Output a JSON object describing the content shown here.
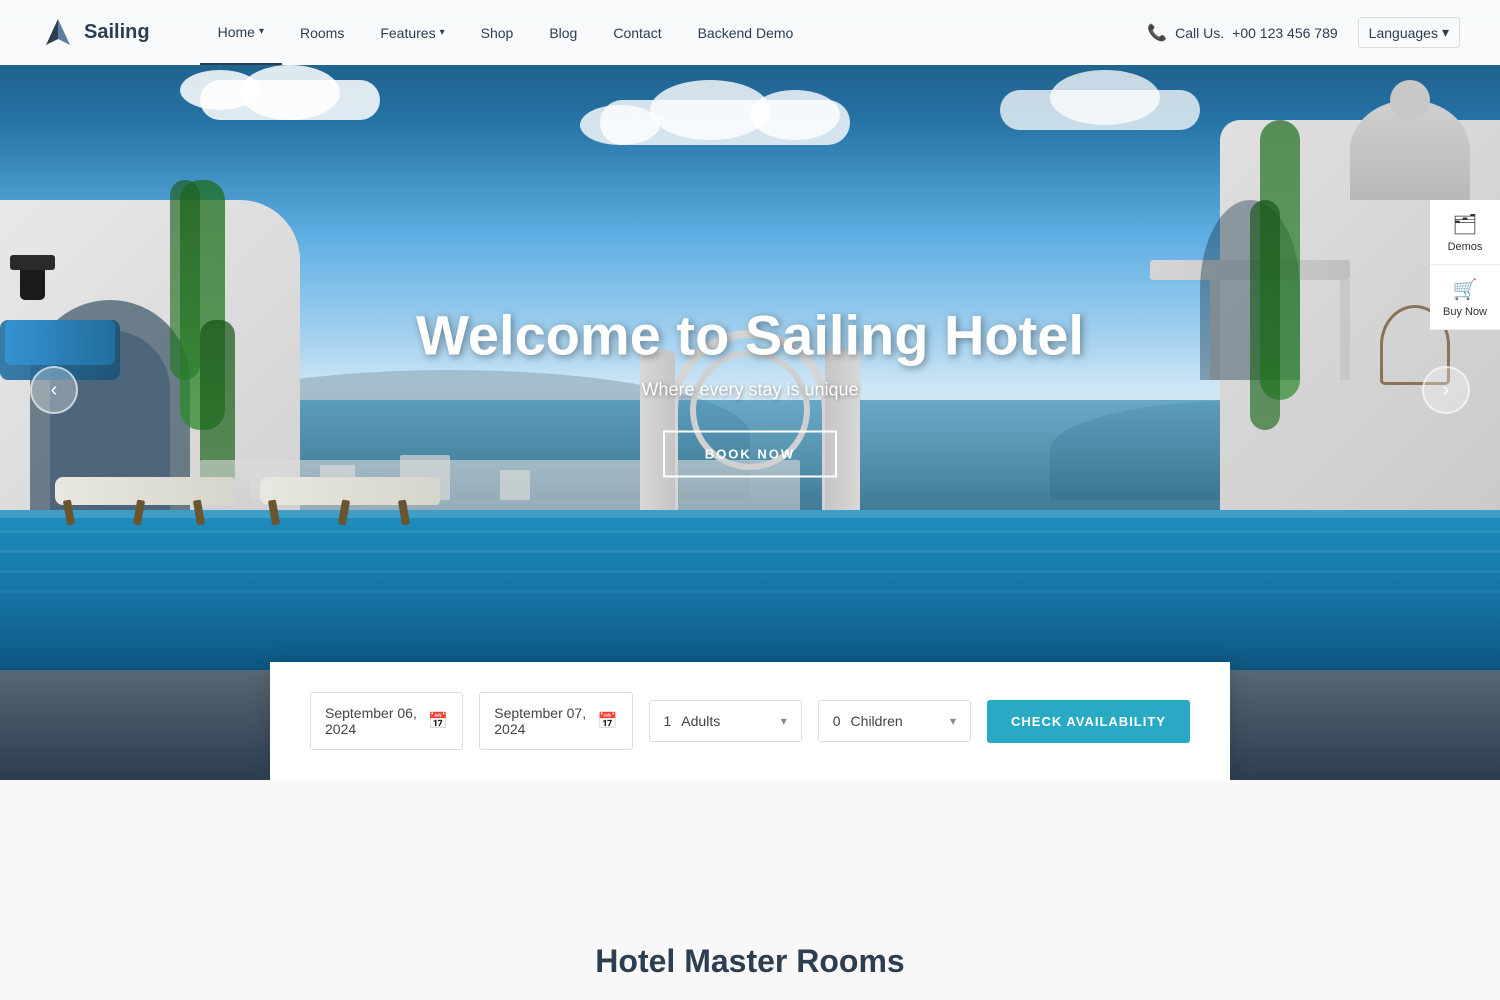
{
  "brand": {
    "name": "Sailing",
    "tagline": "Where every stay is unique"
  },
  "navbar": {
    "logo_text": "Sailing",
    "nav_items": [
      {
        "label": "Home",
        "active": true,
        "has_dropdown": true
      },
      {
        "label": "Rooms",
        "active": false,
        "has_dropdown": false
      },
      {
        "label": "Features",
        "active": false,
        "has_dropdown": true
      },
      {
        "label": "Shop",
        "active": false,
        "has_dropdown": false
      },
      {
        "label": "Blog",
        "active": false,
        "has_dropdown": false
      },
      {
        "label": "Contact",
        "active": false,
        "has_dropdown": false
      },
      {
        "label": "Backend Demo",
        "active": false,
        "has_dropdown": false
      }
    ],
    "call_label": "Call Us.",
    "call_number": "+00 123 456 789",
    "languages_label": "Languages"
  },
  "hero": {
    "title": "Welcome to Sailing Hotel",
    "subtitle": "Where every stay is unique",
    "cta_label": "BOOK NOW"
  },
  "side_widgets": [
    {
      "icon": "🗂",
      "label": "Demos"
    },
    {
      "icon": "🛒",
      "label": "Buy Now"
    }
  ],
  "booking_bar": {
    "check_in": "September 06, 2024",
    "check_out": "September 07, 2024",
    "adults_count": "1",
    "adults_label": "Adults",
    "children_count": "0",
    "children_label": "Children",
    "cta_label": "CHECK AVAILABILITY"
  },
  "bottom": {
    "title": "Hotel Master Rooms"
  },
  "colors": {
    "accent": "#29aac4",
    "dark": "#2c3e50",
    "text": "#444444"
  }
}
